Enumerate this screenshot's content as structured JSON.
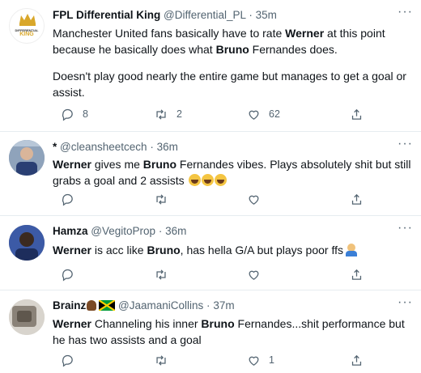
{
  "tweets": [
    {
      "name": "FPL Differential King",
      "handle": "@Differential_PL",
      "dot": "·",
      "time": "35m",
      "more": "···",
      "avatar_text": "KING",
      "avatar_subtext": "DIFFERENTIAL",
      "text_parts": [
        "Manchester United fans basically have to rate ",
        "Werner",
        " at this point because he basically does what ",
        "Bruno",
        " Fernandes does."
      ],
      "text_parts2": [
        "Doesn't play good nearly the entire game but manages to get a goal or assist."
      ],
      "replies": "8",
      "retweets": "2",
      "likes": "62"
    },
    {
      "name_prefix": "*",
      "handle": "@cleansheetcech",
      "dot": "·",
      "time": "36m",
      "more": "···",
      "text_parts": [
        "Werner",
        " gives me ",
        "Bruno",
        " Fernandes vibes. Plays absolutely shit but still grabs a goal and 2 assists "
      ]
    },
    {
      "name": "Hamza",
      "handle": "@VegitoProp",
      "dot": "·",
      "time": "36m",
      "more": "···",
      "text_parts": [
        "Werner",
        " is acc like ",
        "Bruno",
        ", has hella G/A but plays poor ffs"
      ]
    },
    {
      "name": "Brainz",
      "handle": "@JaamaniCollins",
      "dot": "·",
      "time": "37m",
      "more": "···",
      "text_parts": [
        "Werner",
        " Channeling his inner ",
        "Bruno",
        " Fernandes...shit performance but he has two assists and a goal"
      ],
      "likes": "1"
    }
  ],
  "icons": [
    "reply-icon",
    "retweet-icon",
    "like-icon",
    "share-icon"
  ],
  "colors": {
    "text": "#0f1419",
    "secondary": "#536471",
    "border": "#e6ecf0",
    "gold": "#d9a72a"
  }
}
